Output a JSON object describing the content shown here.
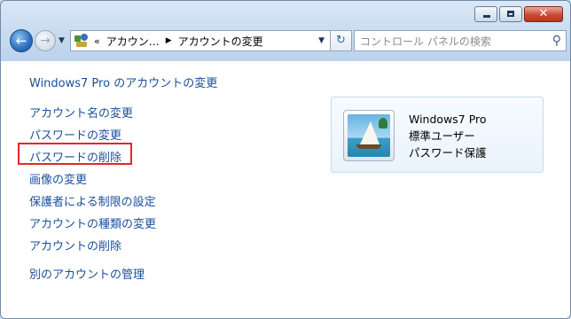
{
  "window": {
    "caption": {
      "minimize_glyph": "minimize-icon",
      "maximize_glyph": "maximize-icon",
      "close_glyph": "✕"
    }
  },
  "nav": {
    "back_glyph": "←",
    "forward_glyph": "→",
    "history_dropdown_glyph": "▼",
    "address": {
      "overflow_chevron": "«",
      "crumbs": [
        "アカウン…",
        "アカウントの変更"
      ],
      "dropdown_glyph": "▼"
    },
    "refresh_glyph": "↻",
    "search": {
      "placeholder": "コントロール パネルの検索"
    }
  },
  "main": {
    "heading": "Windows7 Pro のアカウントの変更",
    "task_links": [
      "アカウント名の変更",
      "パスワードの変更",
      "パスワードの削除",
      "画像の変更",
      "保護者による制限の設定",
      "アカウントの種類の変更",
      "アカウントの削除"
    ],
    "other_link": "別のアカウントの管理",
    "highlighted_link_index": 2,
    "highlight_color": "#e8252a"
  },
  "account": {
    "name": "Windows7 Pro",
    "type": "標準ユーザー",
    "status": "パスワード保護",
    "picture_icon": "sailboat-picture"
  },
  "colors": {
    "link": "#1a4f9c",
    "chrome": "#c6daf0"
  }
}
